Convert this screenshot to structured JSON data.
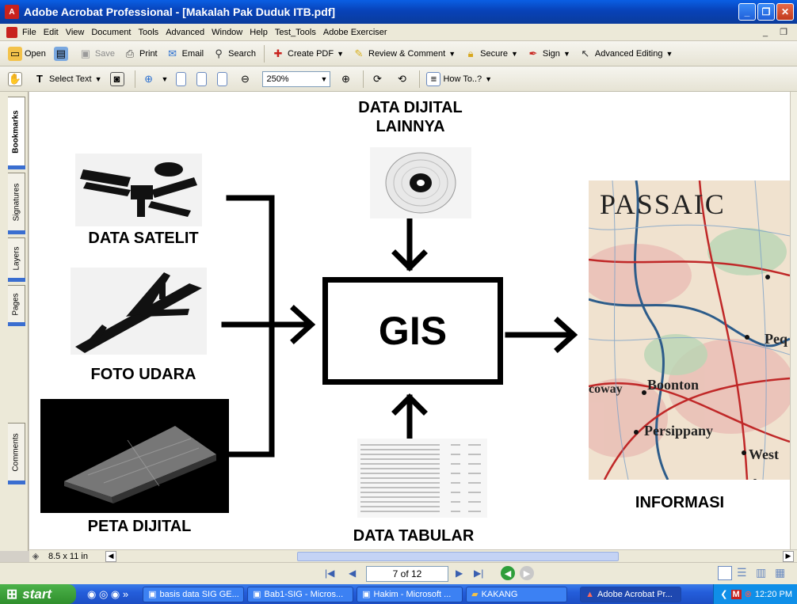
{
  "window": {
    "title": "Adobe Acrobat Professional - [Makalah Pak Duduk ITB.pdf]"
  },
  "menu": [
    "File",
    "Edit",
    "View",
    "Document",
    "Tools",
    "Advanced",
    "Window",
    "Help",
    "Test_Tools",
    "Adobe Exerciser"
  ],
  "toolbar1": {
    "open": "Open",
    "save": "Save",
    "print": "Print",
    "email": "Email",
    "search": "Search",
    "create_pdf": "Create PDF",
    "review": "Review & Comment",
    "secure": "Secure",
    "sign": "Sign",
    "advanced_editing": "Advanced Editing"
  },
  "toolbar2": {
    "select_text": "Select Text",
    "zoom": "250%",
    "how_to": "How To..?"
  },
  "nav_tabs": [
    "Bookmarks",
    "Signatures",
    "Layers",
    "Pages",
    "Comments"
  ],
  "diagram": {
    "data_dijital_lainnya": [
      "DATA DIJITAL",
      "LAINNYA"
    ],
    "data_satelit": "DATA SATELIT",
    "foto_udara": "FOTO UDARA",
    "peta_dijital": "PETA DIJITAL",
    "gis": "GIS",
    "data_tabular": "DATA TABULAR",
    "informasi": "INFORMASI",
    "map_words": [
      "PASSAIC",
      "Boonton",
      "Persippany",
      "West",
      "Peq",
      "coway"
    ]
  },
  "status": {
    "page_size": "8.5 x 11 in",
    "page_indicator": "7 of 12"
  },
  "taskbar": {
    "start": "start",
    "tasks": [
      "basis data SIG GE...",
      "Bab1-SIG - Micros...",
      "Hakim - Microsoft ...",
      "KAKANG",
      "Adobe Acrobat Pr..."
    ],
    "clock": "12:20 PM"
  }
}
